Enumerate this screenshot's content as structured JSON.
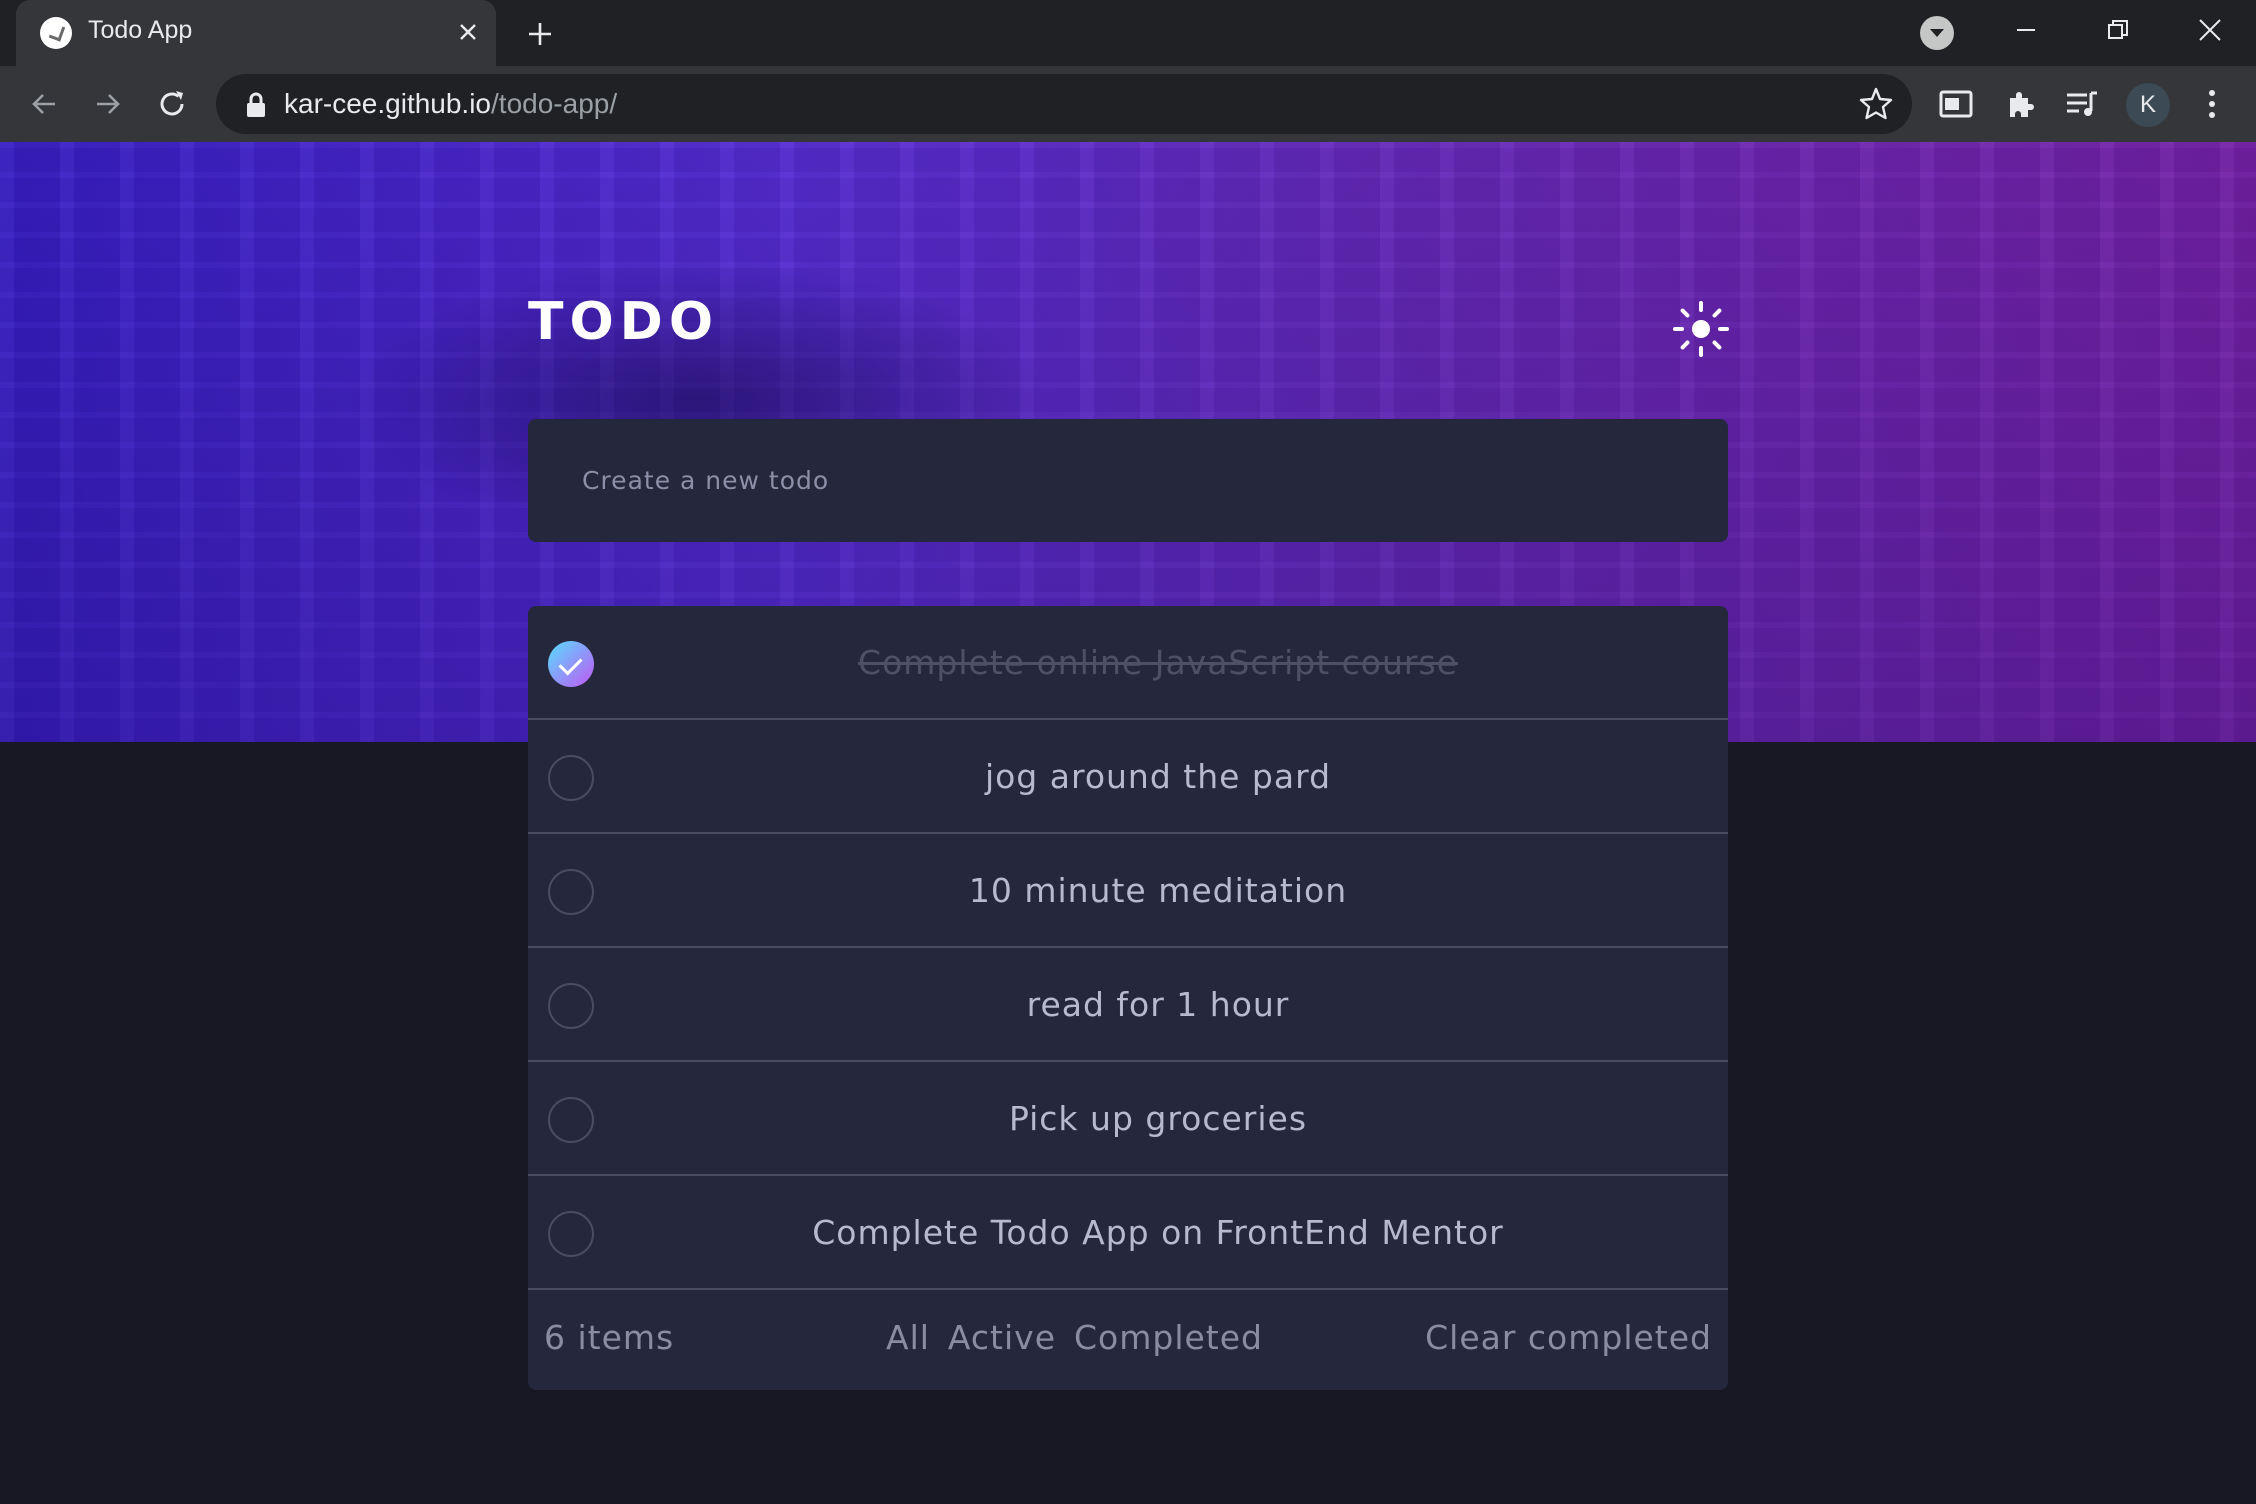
{
  "browser": {
    "tab_title": "Todo App",
    "url_host": "kar-cee.github.io",
    "url_path": "/todo-app/",
    "profile_initial": "K"
  },
  "header": {
    "title": "TODO",
    "theme_icon": "sun-icon"
  },
  "new_todo": {
    "placeholder": "Create a new todo"
  },
  "todos": [
    {
      "text": "Complete online JavaScript course",
      "completed": true
    },
    {
      "text": "jog around the pard",
      "completed": false
    },
    {
      "text": "10 minute meditation",
      "completed": false
    },
    {
      "text": "read for 1 hour",
      "completed": false
    },
    {
      "text": "Pick up groceries",
      "completed": false
    },
    {
      "text": "Complete Todo App on FrontEnd Mentor",
      "completed": false
    }
  ],
  "footer": {
    "items_left": "6 items",
    "filters": [
      "All",
      "Active",
      "Completed"
    ],
    "clear_label": "Clear completed"
  },
  "colors": {
    "card": "#25273d",
    "background": "#171823",
    "check_gradient_start": "#57ddff",
    "check_gradient_end": "#c058f3"
  }
}
